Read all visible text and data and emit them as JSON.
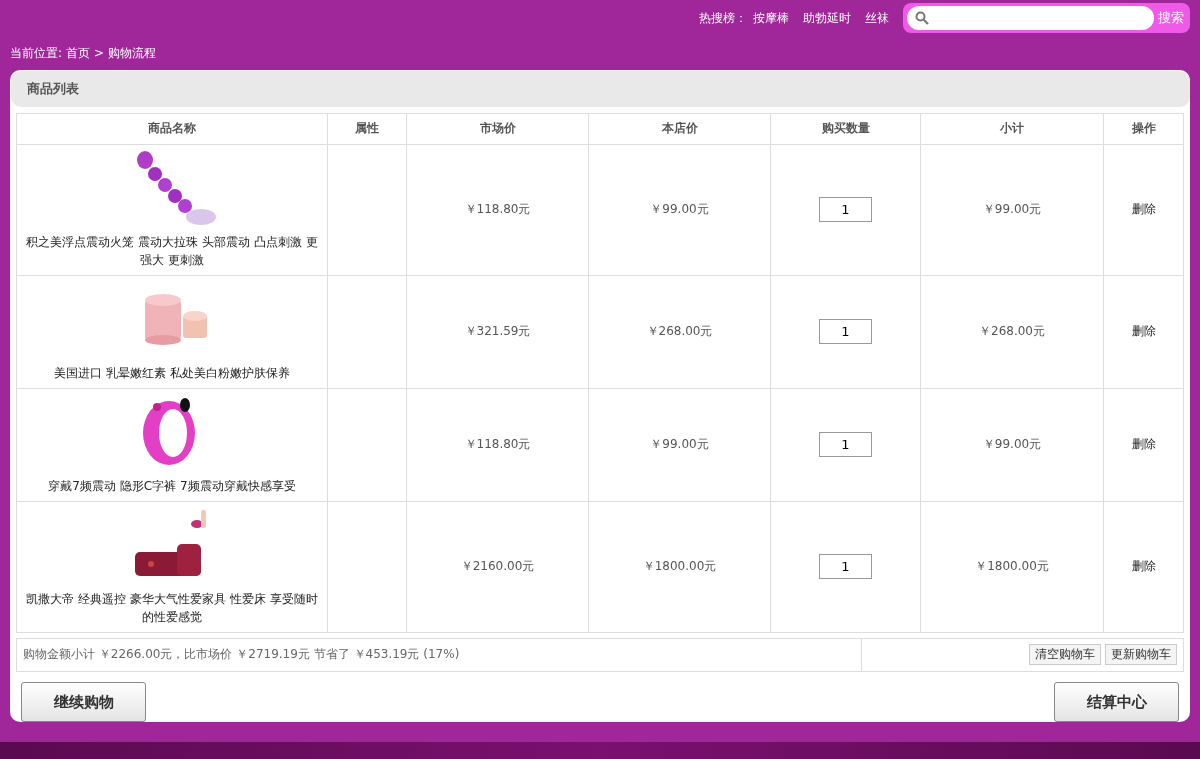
{
  "header": {
    "hot_label": "热搜榜：",
    "hot_links": [
      "按摩棒",
      "助勃延时",
      "丝袜"
    ],
    "search": {
      "button": "搜索"
    }
  },
  "breadcrumb": {
    "label": "当前位置:",
    "items": [
      "首页",
      "购物流程"
    ],
    "separator": ">"
  },
  "panel": {
    "title": "商品列表"
  },
  "table": {
    "columns": [
      "商品名称",
      "属性",
      "市场价",
      "本店价",
      "购买数量",
      "小计",
      "操作"
    ],
    "rows": [
      {
        "name": "积之美浮点震动火笼 震动大拉珠 头部震动 凸点刺激 更强大 更刺激",
        "market_price": "￥118.80元",
        "price": "￥99.00元",
        "quantity": "1",
        "subtotal": "￥99.00元",
        "action": "删除"
      },
      {
        "name": "美国进口 乳晕嫩红素 私处美白粉嫩护肤保养",
        "market_price": "￥321.59元",
        "price": "￥268.00元",
        "quantity": "1",
        "subtotal": "￥268.00元",
        "action": "删除"
      },
      {
        "name": "穿戴7频震动 隐形C字裤 7频震动穿戴快感享受",
        "market_price": "￥118.80元",
        "price": "￥99.00元",
        "quantity": "1",
        "subtotal": "￥99.00元",
        "action": "删除"
      },
      {
        "name": "凯撒大帝 经典遥控 豪华大气性爱家具 性爱床 享受随时的性爱感觉",
        "market_price": "￥2160.00元",
        "price": "￥1800.00元",
        "quantity": "1",
        "subtotal": "￥1800.00元",
        "action": "删除"
      }
    ]
  },
  "summary": {
    "text": "购物金额小计 ￥2266.00元，比市场价 ￥2719.19元 节省了 ￥453.19元 (17%)",
    "buttons": [
      "清空购物车",
      "更新购物车"
    ]
  },
  "actions": {
    "continue": "继续购物",
    "checkout": "结算中心"
  }
}
